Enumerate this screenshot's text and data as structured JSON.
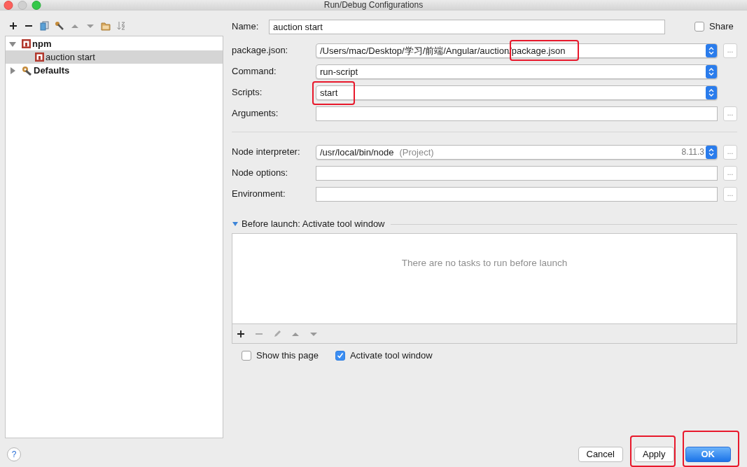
{
  "window": {
    "title": "Run/Debug Configurations"
  },
  "tree": [
    {
      "kind": "npm",
      "label": "npm",
      "expanded": true,
      "selected": false,
      "children": [
        {
          "kind": "npm",
          "label": "auction start",
          "selected": true
        }
      ]
    },
    {
      "kind": "defaults",
      "label": "Defaults",
      "expanded": false,
      "selected": false
    }
  ],
  "name": {
    "label": "Name:",
    "value": "auction start"
  },
  "share": {
    "label": "Share",
    "checked": false
  },
  "groups": [
    [
      {
        "label": "package.json:",
        "kind": "combo",
        "browse": "...",
        "value_parts": [
          {
            "text": "/Users/mac/Desktop/学习/前端/Angular/auction/",
            "highlighted": false
          },
          {
            "text": "package.json",
            "highlighted": true
          }
        ]
      },
      {
        "label": "Command:",
        "kind": "combo",
        "value_parts": [
          {
            "text": "run-script",
            "highlighted": false
          }
        ]
      },
      {
        "label": "Scripts:",
        "kind": "combo",
        "value_parts": [
          {
            "text": "start",
            "highlighted": true
          }
        ]
      },
      {
        "label": "Arguments:",
        "kind": "text",
        "browse": "..."
      }
    ],
    [
      {
        "label": "Node interpreter:",
        "kind": "combo",
        "browse": "...",
        "value_parts": [
          {
            "text": "/usr/local/bin/node",
            "highlighted": false
          }
        ],
        "hint": "(Project)",
        "version": "8.11.3"
      },
      {
        "label": "Node options:",
        "kind": "text",
        "browse": "..."
      },
      {
        "label": "Environment:",
        "kind": "text",
        "browse": "..."
      }
    ]
  ],
  "help": "?",
  "before_launch": {
    "title": "Before launch: Activate tool window",
    "expanded": true,
    "empty_text": "There are no tasks to run before launch"
  },
  "options": [
    {
      "label": "Show this page",
      "checked": false
    },
    {
      "label": "Activate tool window",
      "checked": true
    }
  ],
  "buttons": [
    {
      "label": "Cancel",
      "default": false,
      "highlighted": false
    },
    {
      "label": "Apply",
      "default": false,
      "highlighted": true
    },
    {
      "label": "OK",
      "default": true,
      "highlighted": true
    }
  ]
}
